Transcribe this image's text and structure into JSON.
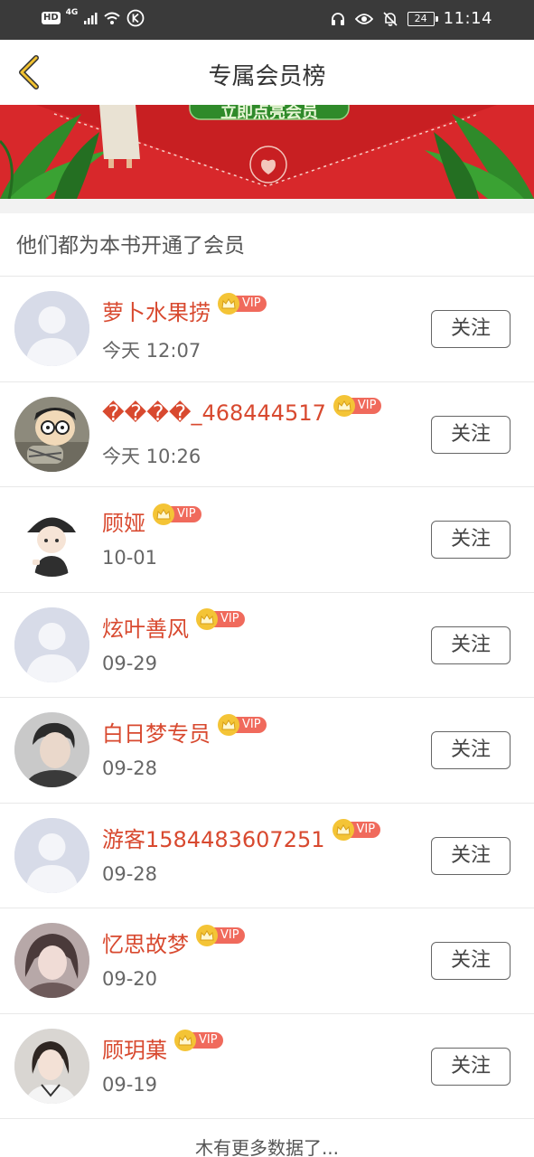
{
  "status_bar": {
    "hd": "HD",
    "net": "4G",
    "time": "11:14",
    "battery": "24"
  },
  "header": {
    "title": "专属会员榜"
  },
  "banner": {
    "button_label": "立即点亮会员",
    "colors": {
      "red": "#d8282b",
      "green": "#3a8f2c"
    }
  },
  "section": {
    "title": "他们都为本书开通了会员"
  },
  "vip_label": "VIP",
  "follow_label": "关注",
  "members": [
    {
      "name": "萝卜水果捞",
      "time": "今天 12:07",
      "avatar": "default-avatar"
    },
    {
      "name": "����_468444517",
      "time": "今天 10:26",
      "avatar": "cartoon-avatar"
    },
    {
      "name": "顾娅",
      "time": "10-01",
      "avatar": "anime-avatar"
    },
    {
      "name": "炫叶善风",
      "time": "09-29",
      "avatar": "default-avatar"
    },
    {
      "name": "白日梦专员",
      "time": "09-28",
      "avatar": "photo-avatar"
    },
    {
      "name": "游客1584483607251",
      "time": "09-28",
      "avatar": "default-avatar"
    },
    {
      "name": "忆思故梦",
      "time": "09-20",
      "avatar": "photo-avatar"
    },
    {
      "name": "顾玥菓",
      "time": "09-19",
      "avatar": "photo-avatar"
    }
  ],
  "footer": {
    "note": "木有更多数据了..."
  },
  "colors": {
    "name": "#d8492f",
    "vip_badge": "#f06a5c",
    "crown": "#f4c436"
  }
}
